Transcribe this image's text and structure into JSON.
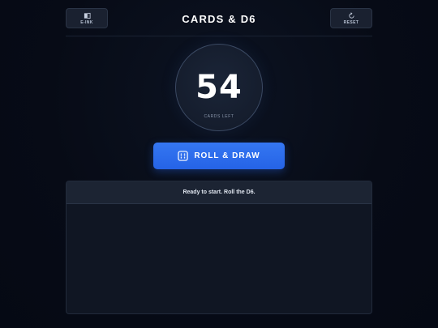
{
  "header": {
    "title": "CARDS & D6",
    "left_button": {
      "label": "E-INK",
      "icon": "book-icon"
    },
    "right_button": {
      "label": "RESET",
      "icon": "refresh-icon"
    }
  },
  "counter": {
    "value": "54",
    "label": "CARDS LEFT"
  },
  "roll_button": {
    "label": "ROLL & DRAW",
    "icon": "dice-icon"
  },
  "log": {
    "status": "Ready to start. Roll the D6."
  },
  "colors": {
    "accent": "#2563e6",
    "background": "#070b16",
    "panel": "#101623"
  }
}
